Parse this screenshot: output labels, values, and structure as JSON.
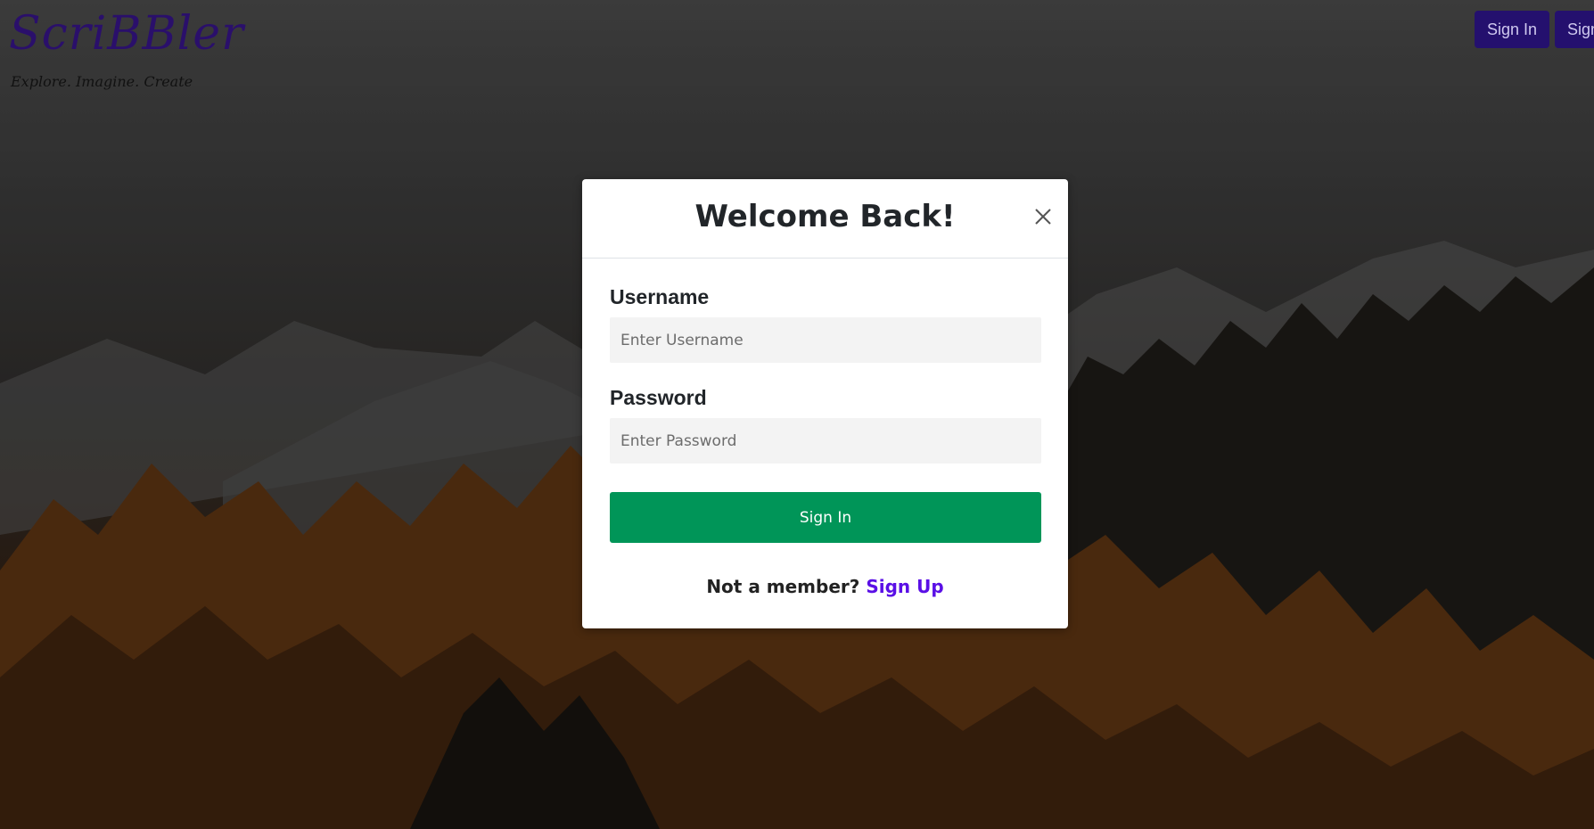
{
  "brand": {
    "title": "ScriBBler",
    "tagline": "Explore. Imagine. Create"
  },
  "nav": {
    "sign_in_label": "Sign In",
    "sign_up_label": "Sign Up"
  },
  "modal": {
    "title": "Welcome Back!",
    "username_label": "Username",
    "username_placeholder": "Enter Username",
    "password_label": "Password",
    "password_placeholder": "Enter Password",
    "submit_label": "Sign In",
    "not_member_text": "Not a member?",
    "signup_link_label": "Sign Up"
  },
  "colors": {
    "brand": "#2a0f6b",
    "nav_button": "#24106e",
    "submit_button": "#009558",
    "link": "#5a0fe6"
  },
  "icons": {
    "close": "close-icon"
  }
}
